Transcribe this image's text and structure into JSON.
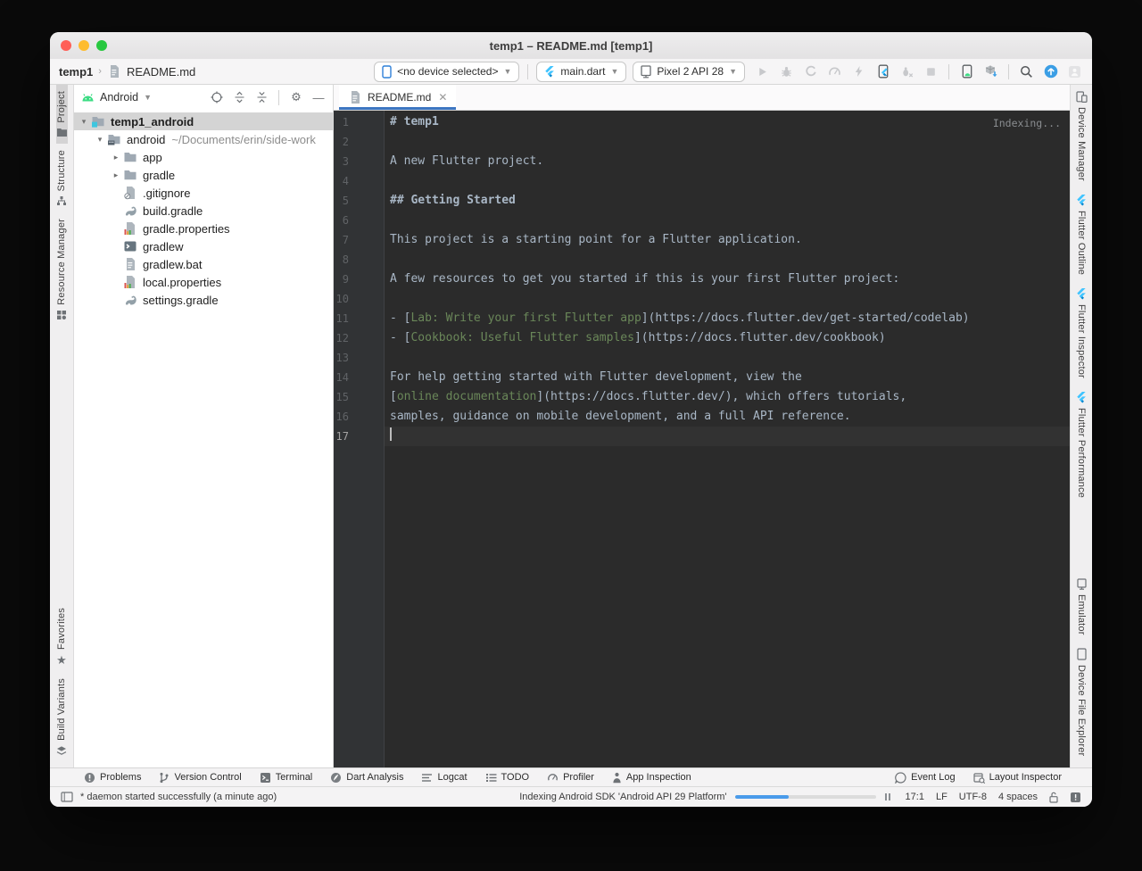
{
  "theme": {
    "accent_blue": "#3c76c1",
    "editor_background": "#2b2b2b",
    "link_green": "#6a8759",
    "android_green": "#3ddc84",
    "flutter_blue": "#40c4ff",
    "traffic_red": "#ff5f57",
    "traffic_yellow": "#febc2e",
    "traffic_green": "#28c840"
  },
  "window": {
    "title": "temp1 – README.md [temp1]"
  },
  "toolbar": {
    "breadcrumb": {
      "project": "temp1",
      "separator": "›",
      "file": "README.md"
    },
    "device_selector": "<no device selected>",
    "run_config": "main.dart",
    "target_device": "Pixel 2 API 28",
    "actions": [
      {
        "name": "run-button",
        "icon": "play-icon",
        "enabled": false
      },
      {
        "name": "debug-button",
        "icon": "bug-icon",
        "enabled": false
      },
      {
        "name": "profile-app-button",
        "icon": "c-profile-icon",
        "enabled": false
      },
      {
        "name": "performance-profiler-button",
        "icon": "gauge-icon",
        "enabled": false
      },
      {
        "name": "apply-changes-button",
        "icon": "lightning-icon",
        "enabled": false
      },
      {
        "name": "flutter-attach-button",
        "icon": "phone-flutter-icon",
        "enabled": true
      },
      {
        "name": "stop-debug-button",
        "icon": "bug-stop-icon",
        "enabled": false
      },
      {
        "name": "stop-button",
        "icon": "stop-icon",
        "enabled": false
      },
      {
        "type": "sep"
      },
      {
        "name": "device-manager-button",
        "icon": "phone-check-icon",
        "enabled": true
      },
      {
        "name": "sdk-manager-button",
        "icon": "sdk-box-icon",
        "enabled": true
      },
      {
        "type": "sep"
      },
      {
        "name": "search-everywhere-button",
        "icon": "search-icon",
        "enabled": true
      },
      {
        "name": "updates-button",
        "icon": "update-icon",
        "enabled": true
      },
      {
        "name": "profile-avatar-button",
        "icon": "avatar-icon",
        "enabled": false
      }
    ]
  },
  "left_stripe": {
    "top": [
      {
        "label": "Project",
        "icon": "project-icon",
        "selected": true
      },
      {
        "label": "Structure",
        "icon": "structure-icon",
        "selected": false
      },
      {
        "label": "Resource Manager",
        "icon": "resource-manager-icon",
        "selected": false
      }
    ],
    "bottom": [
      {
        "label": "Favorites",
        "icon": "star-icon",
        "selected": false
      },
      {
        "label": "Build Variants",
        "icon": "build-variants-icon",
        "selected": false
      }
    ]
  },
  "right_stripe": {
    "top": [
      {
        "label": "Device Manager",
        "icon": "device-manager-icon",
        "selected": false
      },
      {
        "label": "Flutter Outline",
        "icon": "flutter-icon",
        "selected": false
      },
      {
        "label": "Flutter Inspector",
        "icon": "flutter-icon",
        "selected": false
      },
      {
        "label": "Flutter Performance",
        "icon": "flutter-icon",
        "selected": false
      }
    ],
    "bottom": [
      {
        "label": "Emulator",
        "icon": "emulator-icon",
        "selected": false
      },
      {
        "label": "Device File Explorer",
        "icon": "device-explorer-icon",
        "selected": false
      }
    ]
  },
  "project_panel": {
    "mode_label": "Android",
    "tree": [
      {
        "label": "temp1_android",
        "icon": "module-folder",
        "indent": 0,
        "chevron": "down",
        "selected": true,
        "bold": true
      },
      {
        "label": "android",
        "sub": "~/Documents/erin/side-work",
        "icon": "android-folder",
        "indent": 1,
        "chevron": "down"
      },
      {
        "label": "app",
        "icon": "folder",
        "indent": 2,
        "chevron": "right"
      },
      {
        "label": "gradle",
        "icon": "folder",
        "indent": 2,
        "chevron": "right"
      },
      {
        "label": ".gitignore",
        "icon": "gitignore-file",
        "indent": 2
      },
      {
        "label": "build.gradle",
        "icon": "gradle-file",
        "indent": 2
      },
      {
        "label": "gradle.properties",
        "icon": "properties-file",
        "indent": 2
      },
      {
        "label": "gradlew",
        "icon": "console-file",
        "indent": 2
      },
      {
        "label": "gradlew.bat",
        "icon": "text-file",
        "indent": 2
      },
      {
        "label": "local.properties",
        "icon": "properties-file",
        "indent": 2
      },
      {
        "label": "settings.gradle",
        "icon": "gradle-file",
        "indent": 2
      }
    ]
  },
  "editor": {
    "tab_label": "README.md",
    "indexing_label": "Indexing...",
    "active_line": 17,
    "lines": [
      {
        "n": 1,
        "segs": [
          {
            "t": "# temp1",
            "s": "heading"
          }
        ]
      },
      {
        "n": 2,
        "segs": []
      },
      {
        "n": 3,
        "segs": [
          {
            "t": "A new Flutter project.",
            "s": "plain"
          }
        ]
      },
      {
        "n": 4,
        "segs": []
      },
      {
        "n": 5,
        "segs": [
          {
            "t": "## Getting Started",
            "s": "heading"
          }
        ]
      },
      {
        "n": 6,
        "segs": []
      },
      {
        "n": 7,
        "segs": [
          {
            "t": "This project is a starting point for a Flutter application.",
            "s": "plain"
          }
        ]
      },
      {
        "n": 8,
        "segs": []
      },
      {
        "n": 9,
        "segs": [
          {
            "t": "A few resources to get you started if this is your first Flutter project:",
            "s": "plain"
          }
        ]
      },
      {
        "n": 10,
        "segs": []
      },
      {
        "n": 11,
        "segs": [
          {
            "t": "- [",
            "s": "plain"
          },
          {
            "t": "Lab: Write your first Flutter app",
            "s": "link"
          },
          {
            "t": "](https://docs.flutter.dev/get-started/codelab)",
            "s": "plain"
          }
        ]
      },
      {
        "n": 12,
        "segs": [
          {
            "t": "- [",
            "s": "plain"
          },
          {
            "t": "Cookbook: Useful Flutter samples",
            "s": "link"
          },
          {
            "t": "](https://docs.flutter.dev/cookbook)",
            "s": "plain"
          }
        ]
      },
      {
        "n": 13,
        "segs": []
      },
      {
        "n": 14,
        "segs": [
          {
            "t": "For help getting started with Flutter development, view the",
            "s": "plain"
          }
        ]
      },
      {
        "n": 15,
        "segs": [
          {
            "t": "[",
            "s": "plain"
          },
          {
            "t": "online documentation",
            "s": "link"
          },
          {
            "t": "](https://docs.flutter.dev/), which offers tutorials,",
            "s": "plain"
          }
        ]
      },
      {
        "n": 16,
        "segs": [
          {
            "t": "samples, guidance on mobile development, and a full API reference.",
            "s": "plain"
          }
        ]
      },
      {
        "n": 17,
        "segs": []
      }
    ]
  },
  "bottom_bar": {
    "left": [
      {
        "label": "Problems",
        "icon": "problems-icon"
      },
      {
        "label": "Version Control",
        "icon": "version-control-icon"
      },
      {
        "label": "Terminal",
        "icon": "terminal-icon"
      },
      {
        "label": "Dart Analysis",
        "icon": "dart-icon"
      },
      {
        "label": "Logcat",
        "icon": "logcat-icon"
      },
      {
        "label": "TODO",
        "icon": "todo-icon"
      },
      {
        "label": "Profiler",
        "icon": "profiler-icon"
      },
      {
        "label": "App Inspection",
        "icon": "app-inspection-icon"
      }
    ],
    "right": [
      {
        "label": "Event Log",
        "icon": "event-log-icon"
      },
      {
        "label": "Layout Inspector",
        "icon": "layout-inspector-icon"
      }
    ]
  },
  "status_bar": {
    "message": "* daemon started successfully (a minute ago)",
    "indexing": "Indexing Android SDK 'Android API 29 Platform'",
    "progress_pct": 38,
    "caret_position": "17:1",
    "line_ending": "LF",
    "encoding": "UTF-8",
    "indent": "4 spaces"
  }
}
